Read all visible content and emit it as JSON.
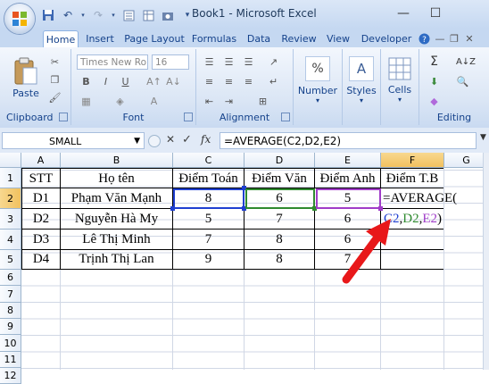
{
  "window": {
    "title": "Book1 - Microsoft Excel",
    "minimize": "—",
    "maximize": "☐"
  },
  "tabs": [
    "Home",
    "Insert",
    "Page Layout",
    "Formulas",
    "Data",
    "Review",
    "View",
    "Developer"
  ],
  "ribbon": {
    "clipboard": {
      "label": "Clipboard",
      "paste": "Paste"
    },
    "font": {
      "label": "Font",
      "font_name": "Times New Ro",
      "font_size": "16",
      "bold": "B",
      "italic": "I",
      "underline": "U",
      "color_a": "A"
    },
    "alignment": {
      "label": "Alignment"
    },
    "number": {
      "label": "Number",
      "button": "Number",
      "symbol": "%"
    },
    "styles": {
      "button": "Styles",
      "symbol": "A"
    },
    "cells": {
      "button": "Cells"
    },
    "editing": {
      "label": "Editing",
      "sigma": "Σ",
      "sort": "A↓Z"
    }
  },
  "formula_bar": {
    "name_box": "SMALL",
    "fx": "fx",
    "cancel": "✕",
    "enter": "✓",
    "formula": "=AVERAGE(C2,D2,E2)"
  },
  "columns": [
    "A",
    "B",
    "C",
    "D",
    "E",
    "F",
    "G"
  ],
  "rows": [
    "1",
    "2",
    "3",
    "4",
    "5",
    "6",
    "7",
    "8",
    "9",
    "10",
    "11",
    "12"
  ],
  "sheet": {
    "header": [
      "STT",
      "Họ tên",
      "Điểm Toán",
      "Điểm Văn",
      "Điểm Anh",
      "Điểm T.B"
    ],
    "data": [
      [
        "D1",
        "Phạm Văn Mạnh",
        "8",
        "6",
        "5"
      ],
      [
        "D2",
        "Nguyễn Hà My",
        "5",
        "7",
        "6"
      ],
      [
        "D3",
        "Lê Thị Minh",
        "7",
        "8",
        "6"
      ],
      [
        "D4",
        "Trịnh Thị Lan",
        "9",
        "8",
        "7"
      ]
    ],
    "editing_cell_line1": "=AVERAGE(",
    "editing_args": {
      "c2": "C2",
      "d2": "D2",
      "e2": "E2",
      "sep1": ",",
      "sep2": ",",
      "close": ")"
    }
  },
  "colors": {
    "ref_blue": "#1f3fd1",
    "ref_green": "#2f8a2f",
    "ref_purple": "#a03cc8",
    "arrow_red": "#e8181a"
  }
}
